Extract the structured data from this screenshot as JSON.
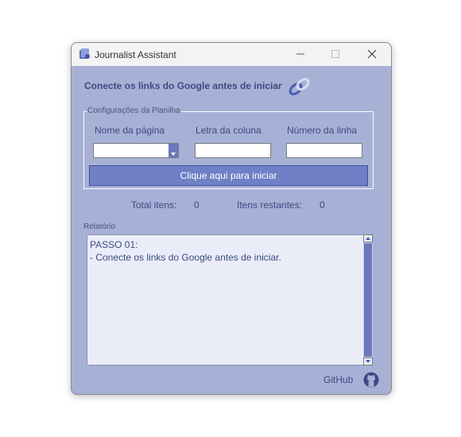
{
  "window": {
    "title": "Journalist Assistant"
  },
  "header": {
    "connect_label": "Conecte os links do Google antes de iniciar"
  },
  "config": {
    "legend": "Configurações da Planilha",
    "sheet_name_label": "Nome da página",
    "column_letter_label": "Letra da coluna",
    "row_number_label": "Número da linha",
    "sheet_name_value": "",
    "column_letter_value": "",
    "row_number_value": "",
    "start_button": "Clique aqui para iniciar"
  },
  "stats": {
    "total_label": "Total itens:",
    "total_value": "0",
    "remaining_label": "Itens restantes:",
    "remaining_value": "0"
  },
  "report": {
    "label": "Relatório",
    "text": "PASSO 01:\n- Conecte os links do Google antes de iniciar."
  },
  "footer": {
    "github_label": "GitHub"
  },
  "colors": {
    "window_bg": "#a7b1d6",
    "accent": "#6f80c6",
    "text": "#3c4a80"
  },
  "icons": {
    "app": "app-icon",
    "link": "link-icon",
    "github": "github-icon"
  }
}
